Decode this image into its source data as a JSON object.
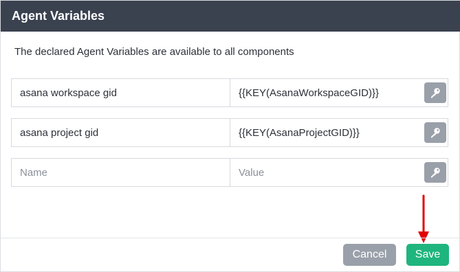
{
  "dialog": {
    "title": "Agent Variables",
    "description": "The declared Agent Variables are available to all components"
  },
  "variables": [
    {
      "name": "asana workspace gid",
      "value": "{{KEY(AsanaWorkspaceGID)}}"
    },
    {
      "name": "asana project gid",
      "value": "{{KEY(AsanaProjectGID)}}"
    }
  ],
  "new_variable": {
    "name_placeholder": "Name",
    "value_placeholder": "Value"
  },
  "buttons": {
    "cancel": "Cancel",
    "save": "Save"
  },
  "colors": {
    "header_bg": "#3a4250",
    "save_bg": "#1fb57e",
    "cancel_bg": "#9aa0a9",
    "key_button_bg": "#9aa0a9",
    "annotation_arrow": "#e00000"
  },
  "icons": {
    "key_button": "key-icon",
    "annotation": "red-arrow-down-icon"
  }
}
